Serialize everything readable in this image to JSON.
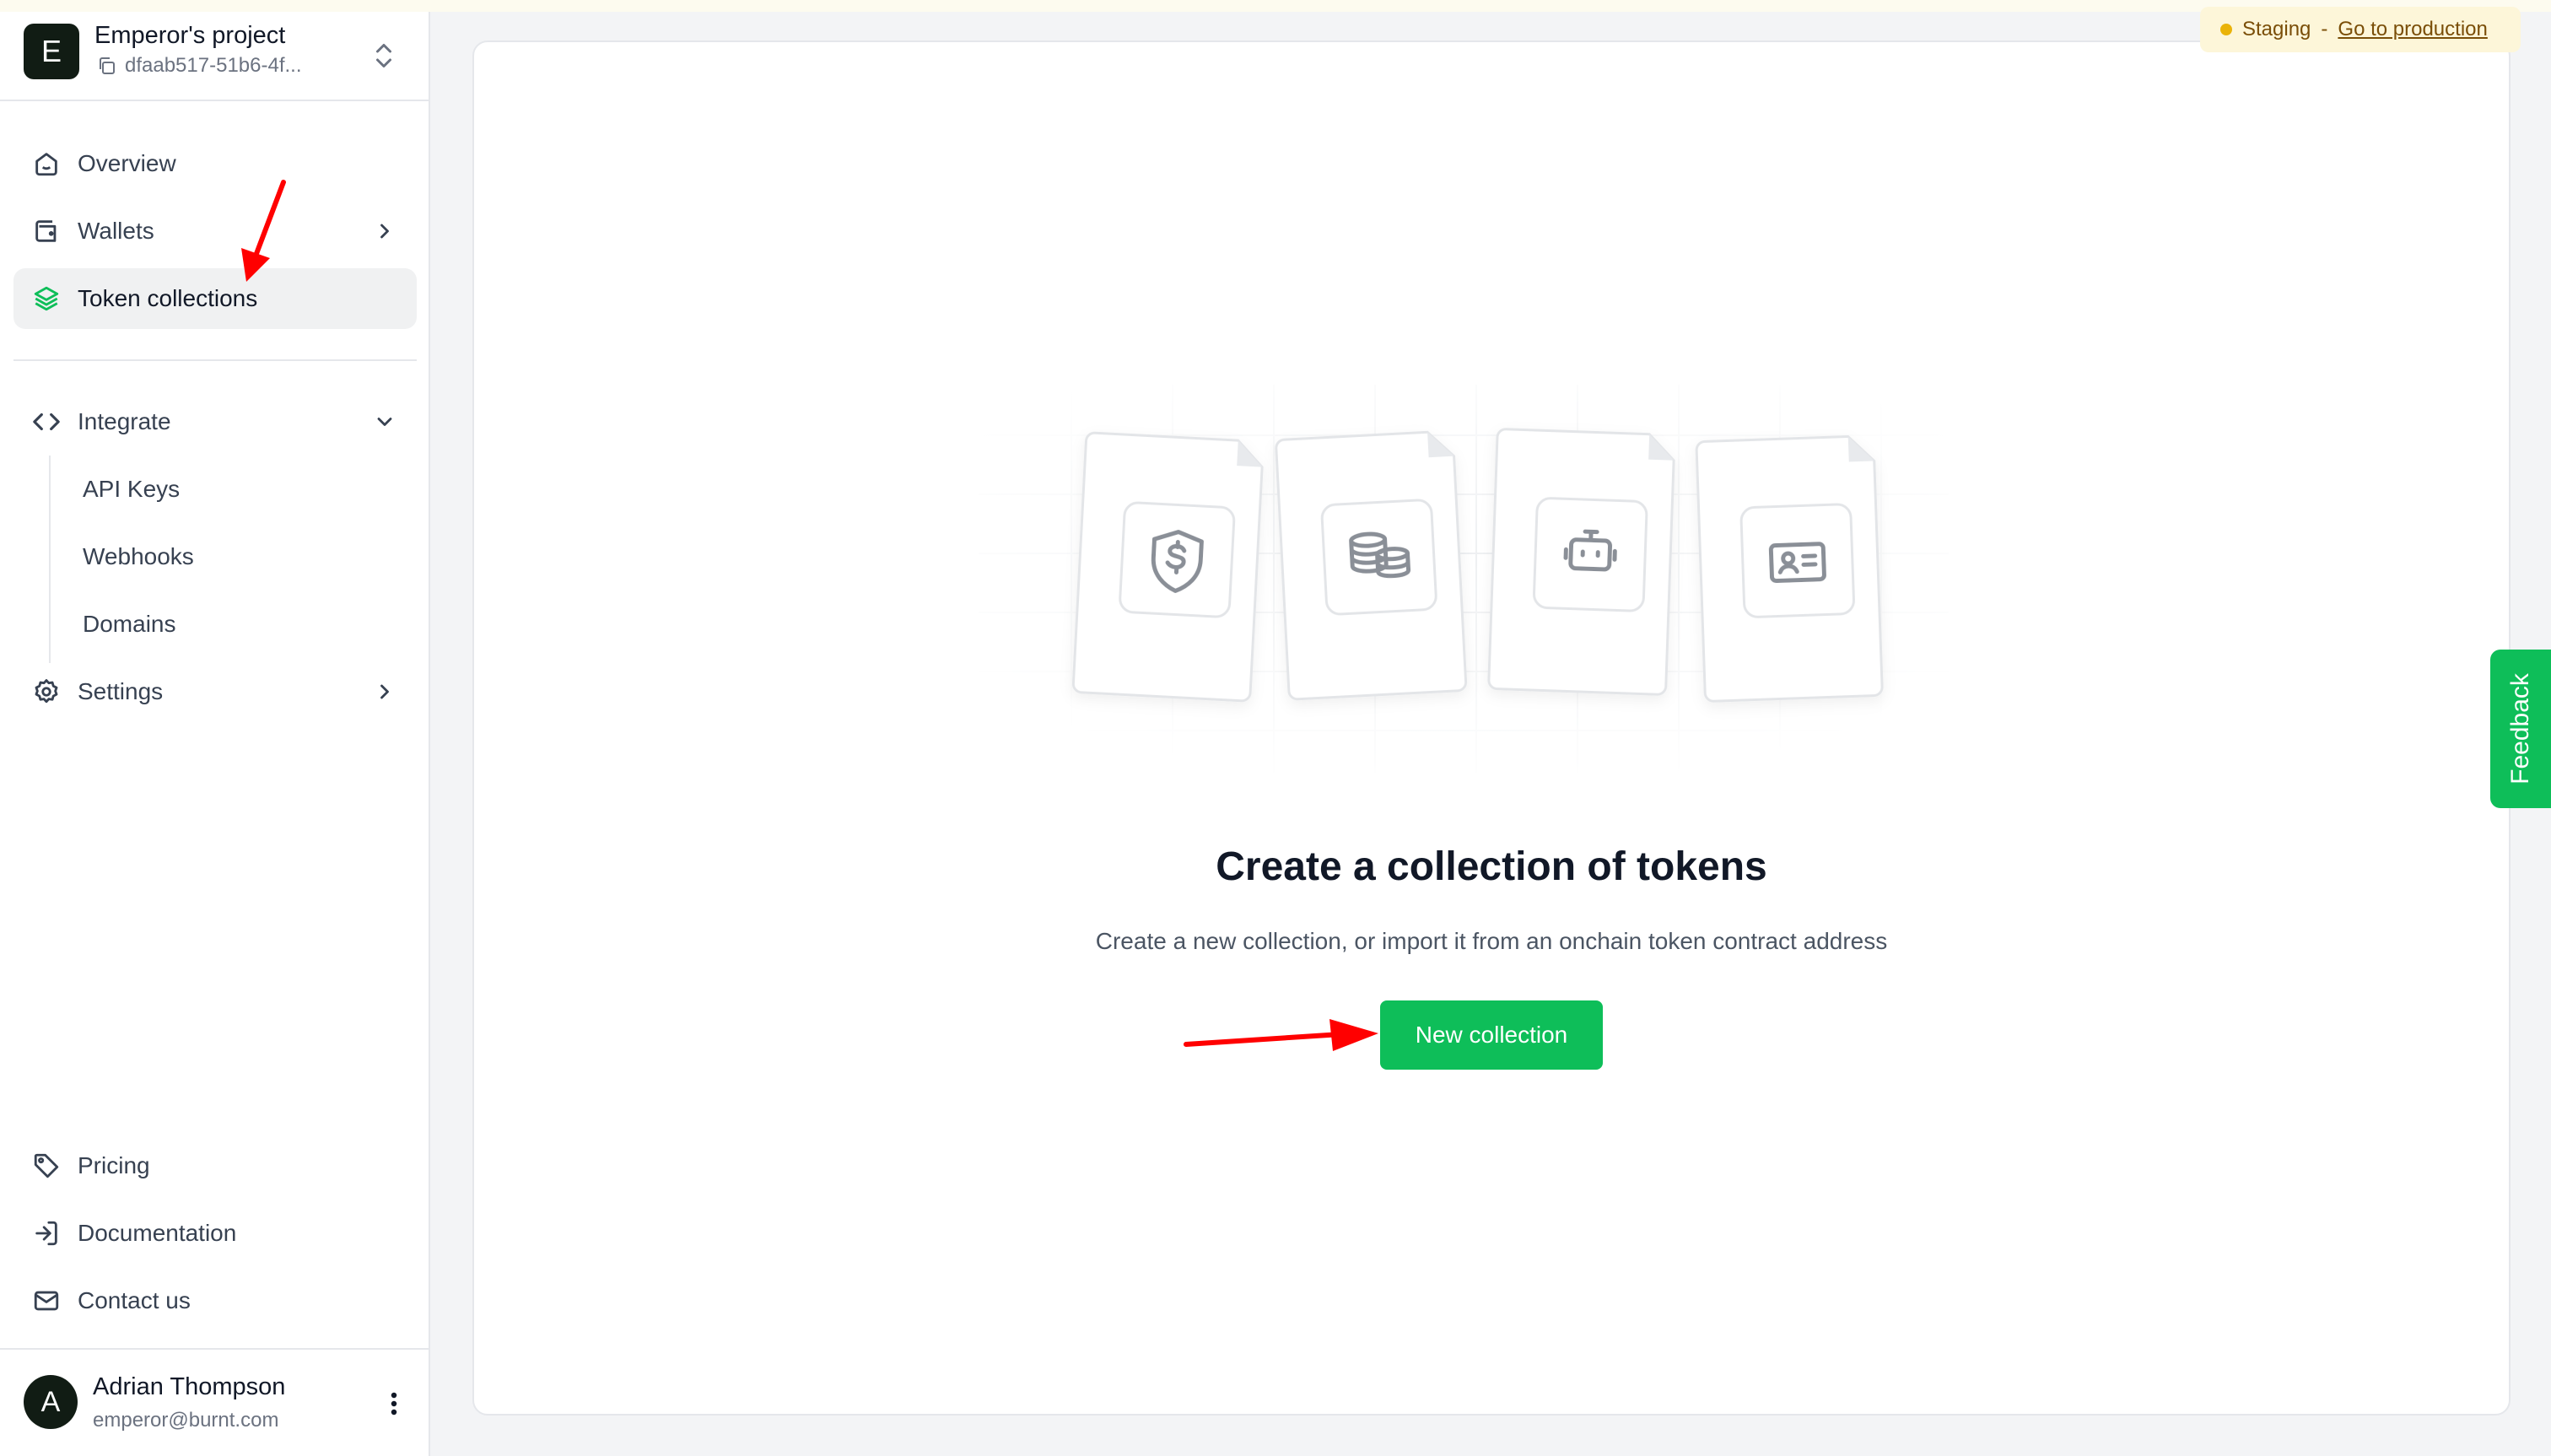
{
  "project": {
    "avatar_letter": "E",
    "name": "Emperor's project",
    "id": "dfaab517-51b6-4f..."
  },
  "nav": {
    "overview": "Overview",
    "wallets": "Wallets",
    "token_collections": "Token collections",
    "integrate": "Integrate",
    "api_keys": "API Keys",
    "webhooks": "Webhooks",
    "domains": "Domains",
    "settings": "Settings",
    "pricing": "Pricing",
    "documentation": "Documentation",
    "contact_us": "Contact us"
  },
  "user": {
    "avatar_letter": "A",
    "name": "Adrian Thompson",
    "email": "emperor@burnt.com"
  },
  "environment": {
    "label": "Staging",
    "separator": "-",
    "link": "Go to production"
  },
  "empty_state": {
    "title": "Create a collection of tokens",
    "description": "Create a new collection, or import it from an onchain token contract address",
    "button": "New collection",
    "icons": [
      "shield-dollar-icon",
      "coins-icon",
      "robot-icon",
      "id-card-icon"
    ]
  },
  "feedback": {
    "label": "Feedback"
  },
  "colors": {
    "accent": "#0ebe59",
    "staging_dot": "#eab308",
    "annotation": "#ff0000"
  }
}
